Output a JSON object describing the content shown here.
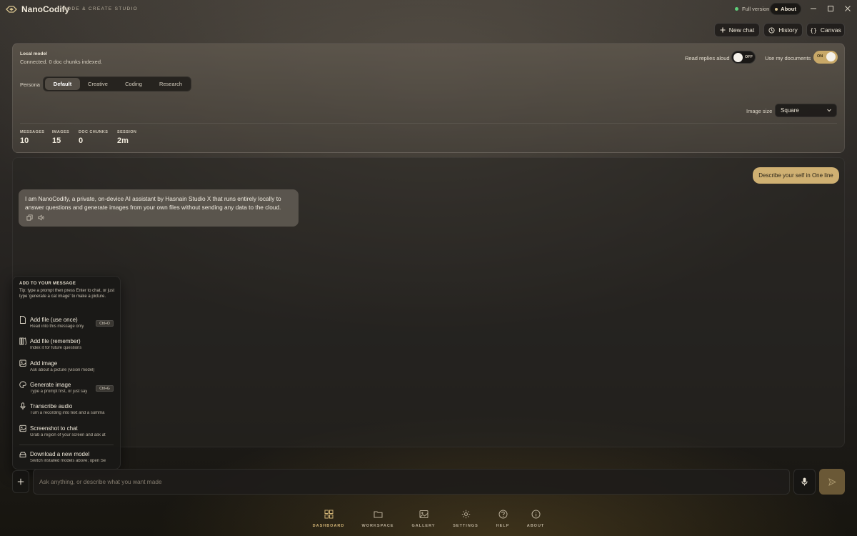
{
  "app": {
    "name": "NanoCodify",
    "tagline": "CODE & CREATE STUDIO",
    "version_status": "Full version",
    "about_label": "About"
  },
  "top_actions": {
    "new_chat": "New chat",
    "history": "History",
    "canvas": "Canvas"
  },
  "model": {
    "label": "Local model",
    "status": "Connected. 0 doc chunks indexed."
  },
  "toggles": {
    "read_aloud": {
      "label": "Read replies aloud",
      "state": "OFF"
    },
    "use_docs": {
      "label": "Use my documents",
      "state": "ON"
    }
  },
  "persona": {
    "label": "Persona",
    "options": [
      "Default",
      "Creative",
      "Coding",
      "Research"
    ],
    "selected": "Default"
  },
  "image_size": {
    "label": "Image size",
    "value": "Square"
  },
  "stats": [
    {
      "label": "MESSAGES",
      "value": "10"
    },
    {
      "label": "IMAGES",
      "value": "15"
    },
    {
      "label": "DOC CHUNKS",
      "value": "0"
    },
    {
      "label": "SESSION",
      "value": "2m"
    }
  ],
  "chat": {
    "user_message": "Describe your self in One line",
    "ai_message": "I am NanoCodify, a private, on-device AI assistant by Hasnain Studio X that runs entirely locally to answer questions and generate images from your own files without sending any data to the cloud."
  },
  "attach_menu": {
    "title": "ADD TO YOUR MESSAGE",
    "tip": "Tip: type a prompt then press Enter to chat, or just type 'generate a cat image' to make a picture.",
    "items": [
      {
        "icon": "file-icon",
        "title": "Add file (use once)",
        "subtitle": "Read into this message only",
        "shortcut": "Ctrl+O"
      },
      {
        "icon": "library-icon",
        "title": "Add file (remember)",
        "subtitle": "Index it for future questions",
        "shortcut": ""
      },
      {
        "icon": "image-icon",
        "title": "Add image",
        "subtitle": "Ask about a picture (vision model)",
        "shortcut": ""
      },
      {
        "icon": "palette-icon",
        "title": "Generate image",
        "subtitle": "Type a prompt first, or just say",
        "shortcut": "Ctrl+G"
      },
      {
        "icon": "mic-icon",
        "title": "Transcribe audio",
        "subtitle": "Turn a recording into text and a summa",
        "shortcut": ""
      },
      {
        "icon": "screenshot-icon",
        "title": "Screenshot to chat",
        "subtitle": "Grab a region of your screen and ask at",
        "shortcut": ""
      },
      {
        "icon": "download-icon",
        "title": "Download a new model",
        "subtitle": "Switch installed models above; open Se",
        "shortcut": ""
      }
    ]
  },
  "composer": {
    "placeholder": "Ask anything, or describe what you want made"
  },
  "nav": [
    {
      "label": "DASHBOARD",
      "icon": "dashboard-icon",
      "active": true
    },
    {
      "label": "WORKSPACE",
      "icon": "folder-icon",
      "active": false
    },
    {
      "label": "GALLERY",
      "icon": "gallery-icon",
      "active": false
    },
    {
      "label": "SETTINGS",
      "icon": "gear-icon",
      "active": false
    },
    {
      "label": "HELP",
      "icon": "help-icon",
      "active": false
    },
    {
      "label": "ABOUT",
      "icon": "info-icon",
      "active": false
    }
  ],
  "colors": {
    "accent": "#cfb072",
    "status_green": "#5ed07a"
  }
}
